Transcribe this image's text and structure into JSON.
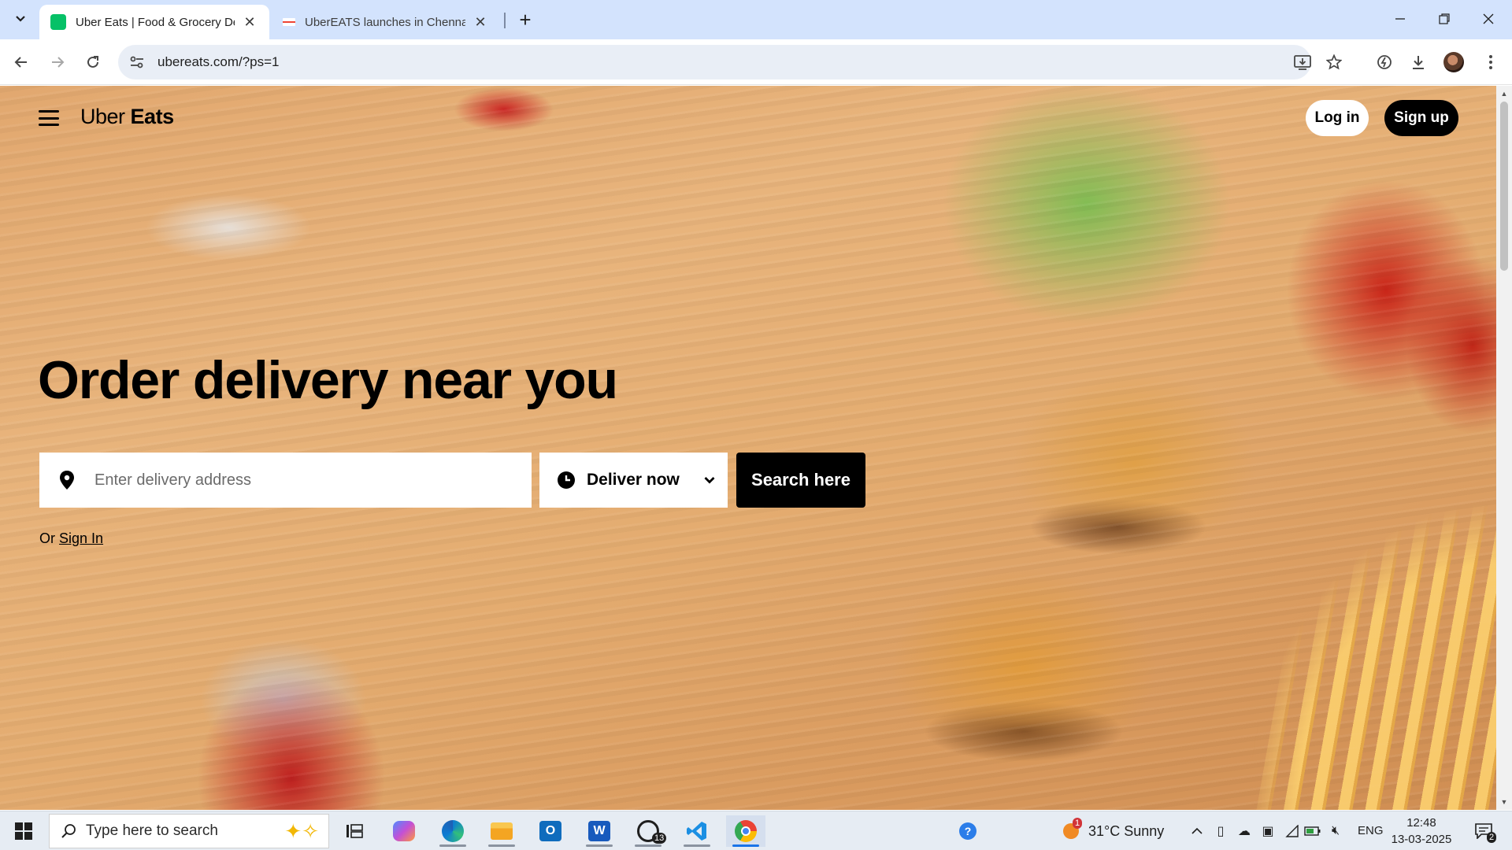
{
  "browser": {
    "tabs": [
      {
        "title": "Uber Eats | Food & Grocery Del",
        "active": true
      },
      {
        "title": "UberEATS launches in Chennai,",
        "active": false
      }
    ],
    "url": "ubereats.com/?ps=1"
  },
  "header": {
    "logo_light": "Uber",
    "logo_bold": "Eats",
    "login_label": "Log in",
    "signup_label": "Sign up"
  },
  "hero": {
    "title": "Order delivery near you",
    "address_placeholder": "Enter delivery address",
    "deliver_label": "Deliver now",
    "search_label": "Search here",
    "or_text": "Or",
    "signin_label": "Sign In"
  },
  "taskbar": {
    "search_placeholder": "Type here to search",
    "whatsapp_badge": "13",
    "weather_badge": "1",
    "weather": "31°C  Sunny",
    "language": "ENG",
    "time": "12:48",
    "date": "13-03-2025",
    "notifications": "2"
  },
  "colors": {
    "tabstrip": "#d3e3fd",
    "uber_green": "#06c167",
    "accent_blue": "#1a73e8"
  }
}
